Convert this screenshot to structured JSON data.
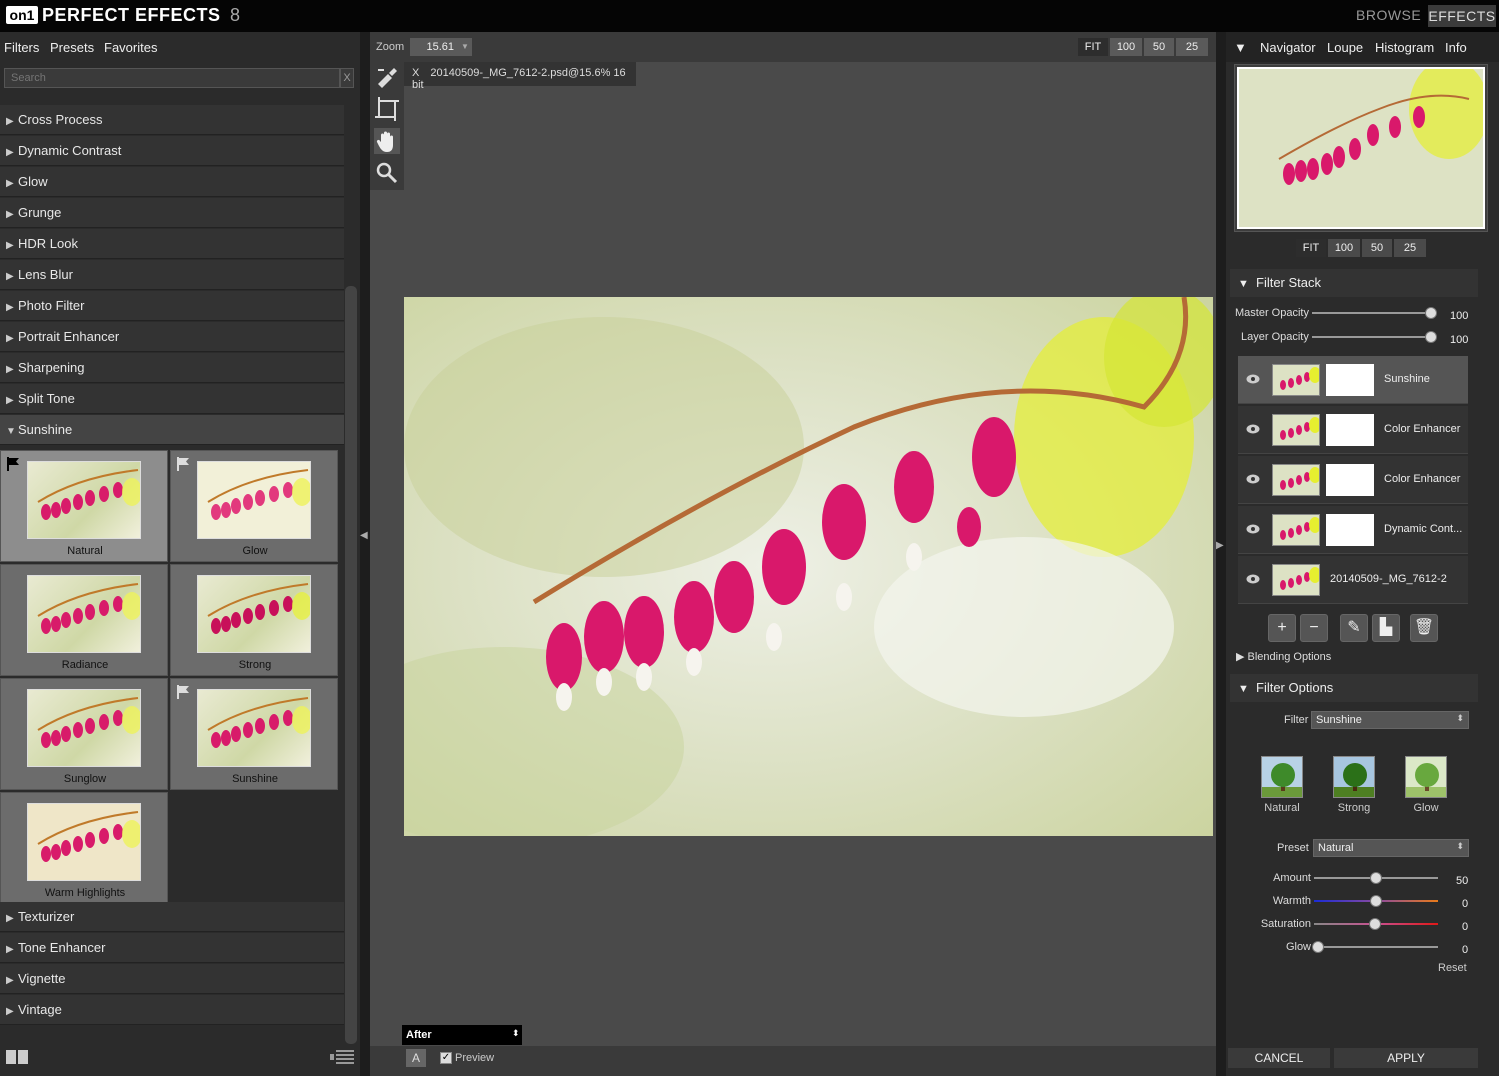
{
  "app": {
    "logo": "on1",
    "title": "PERFECT EFFECTS",
    "version": "8",
    "nav_browse": "BROWSE",
    "nav_effects": "EFFECTS"
  },
  "left": {
    "tabs": [
      "Filters",
      "Presets",
      "Favorites"
    ],
    "search_placeholder": "Search",
    "search_clear": "X",
    "categories_top": [
      "Cross Process",
      "Dynamic Contrast",
      "Glow",
      "Grunge",
      "HDR Look",
      "Lens Blur",
      "Photo Filter",
      "Portrait Enhancer",
      "Sharpening",
      "Split Tone"
    ],
    "expanded_category": "Sunshine",
    "presets": [
      "Natural",
      "Glow",
      "Radiance",
      "Strong",
      "Sunglow",
      "Sunshine",
      "Warm Highlights"
    ],
    "categories_bottom": [
      "Texturizer",
      "Tone Enhancer",
      "Vignette",
      "Vintage"
    ]
  },
  "center": {
    "zoom_label": "Zoom",
    "zoom_value": "15.61",
    "zoom_buttons": [
      "FIT",
      "100",
      "50",
      "25"
    ],
    "doc_close": "X",
    "doc_title": "20140509-_MG_7612-2.psd@15.6% 16 bit",
    "view_mode": "After",
    "a_button": "A",
    "preview_label": "Preview",
    "preview_checked": "✓"
  },
  "right": {
    "tabs": [
      "Navigator",
      "Loupe",
      "Histogram",
      "Info"
    ],
    "nav_zoom_buttons": [
      "FIT",
      "100",
      "50",
      "25"
    ],
    "filter_stack": {
      "title": "Filter Stack",
      "master_opacity_label": "Master Opacity",
      "master_opacity": "100",
      "layer_opacity_label": "Layer Opacity",
      "layer_opacity": "100",
      "layers": [
        "Sunshine",
        "Color Enhancer",
        "Color Enhancer",
        "Dynamic Cont...",
        "20140509-_MG_7612-2"
      ],
      "blending_options": "Blending Options"
    },
    "filter_options": {
      "title": "Filter Options",
      "filter_label": "Filter",
      "filter_value": "Sunshine",
      "tiles": [
        "Natural",
        "Strong",
        "Glow"
      ],
      "preset_label": "Preset",
      "preset_value": "Natural",
      "sliders": [
        {
          "label": "Amount",
          "value": "50"
        },
        {
          "label": "Warmth",
          "value": "0"
        },
        {
          "label": "Saturation",
          "value": "0"
        },
        {
          "label": "Glow",
          "value": "0"
        }
      ],
      "reset": "Reset"
    },
    "cancel": "CANCEL",
    "apply": "APPLY"
  }
}
